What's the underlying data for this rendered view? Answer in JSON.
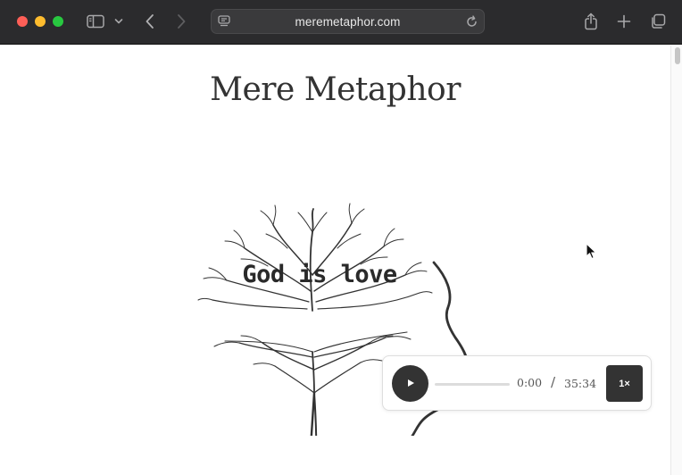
{
  "browser": {
    "url": "meremetaphor.com",
    "colors": {
      "close": "#fe5f57",
      "minimize": "#febc2e",
      "zoom": "#28c840",
      "toolbar": "#2b2b2d"
    },
    "icons": [
      "sidebar-icon",
      "chevron-down-icon",
      "back-icon",
      "forward-icon",
      "page-settings-icon",
      "reload-icon",
      "share-icon",
      "new-tab-icon",
      "tab-overview-icon"
    ]
  },
  "page": {
    "title": "Mere Metaphor",
    "illustration_text": "God is love"
  },
  "player": {
    "current_time": "0:00",
    "separator": "/",
    "total_time": "35:34",
    "speed": "1×",
    "progress": 0
  }
}
